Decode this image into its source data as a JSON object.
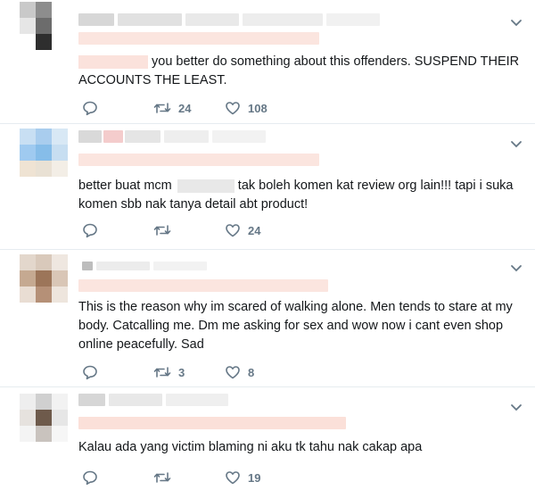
{
  "tweets": [
    {
      "text": "you better do something about this offenders. SUSPEND THEIR ACCOUNTS THE LEAST.",
      "retweets": "24",
      "likes": "108"
    },
    {
      "text_before": "better buat mcm",
      "text_after": "tak boleh komen kat review org lain!!! tapi i suka komen sbb nak tanya detail abt product!",
      "retweets": "",
      "likes": "24"
    },
    {
      "text": "This is the reason why im scared of walking alone. Men tends to stare at my body. Catcalling me. Dm me asking for sex and wow now i cant even shop online peacefully. Sad",
      "retweets": "3",
      "likes": "8"
    },
    {
      "text": "Kalau ada yang victim blaming ni aku tk tahu nak cakap apa",
      "retweets": "",
      "likes": "19"
    }
  ],
  "icons": {
    "reply": "reply-icon",
    "retweet": "retweet-icon",
    "like": "heart-icon",
    "caret": "chevron-down-icon"
  },
  "colors": {
    "icon": "#657786",
    "text": "#14171a",
    "divider": "#e6ecf0"
  }
}
